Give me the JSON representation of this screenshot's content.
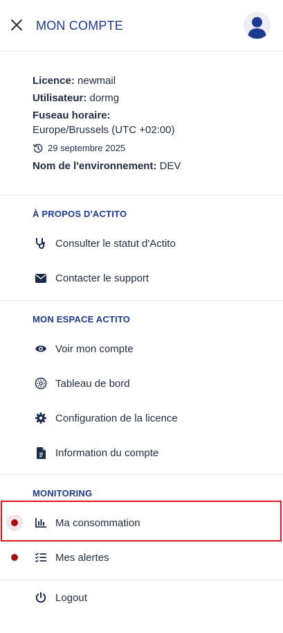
{
  "header": {
    "title": "MON COMPTE",
    "close_icon": "close-icon",
    "avatar_icon": "user-avatar-icon"
  },
  "account": {
    "license_label": "Licence:",
    "license_value": "newmail",
    "user_label": "Utilisateur:",
    "user_value": "dormg",
    "timezone_label": "Fuseau horaire:",
    "timezone_value": "Europe/Brussels (UTC +02:00)",
    "date": "29 septembre 2025",
    "env_label": "Nom de l'environnement:",
    "env_value": "DEV"
  },
  "sections": {
    "about": {
      "title": "À PROPOS D'ACTITO",
      "items": [
        {
          "label": "Consulter le statut d'Actito",
          "icon": "stethoscope-icon"
        },
        {
          "label": "Contacter le support",
          "icon": "envelope-icon"
        }
      ]
    },
    "space": {
      "title": "MON ESPACE ACTITO",
      "items": [
        {
          "label": "Voir mon compte",
          "icon": "eye-icon"
        },
        {
          "label": "Tableau de bord",
          "icon": "dashboard-icon"
        },
        {
          "label": "Configuration de la licence",
          "icon": "gear-icon"
        },
        {
          "label": "Information du compte",
          "icon": "document-icon"
        }
      ]
    },
    "monitoring": {
      "title": "MONITORING",
      "items": [
        {
          "label": "Ma consommation",
          "icon": "bar-chart-icon"
        },
        {
          "label": "Mes alertes",
          "icon": "checklist-icon"
        }
      ]
    }
  },
  "logout": {
    "label": "Logout",
    "icon": "power-icon"
  },
  "colors": {
    "accent": "#1c3a8e",
    "alert_dot": "#a80e14",
    "highlight": "#e0141b"
  }
}
